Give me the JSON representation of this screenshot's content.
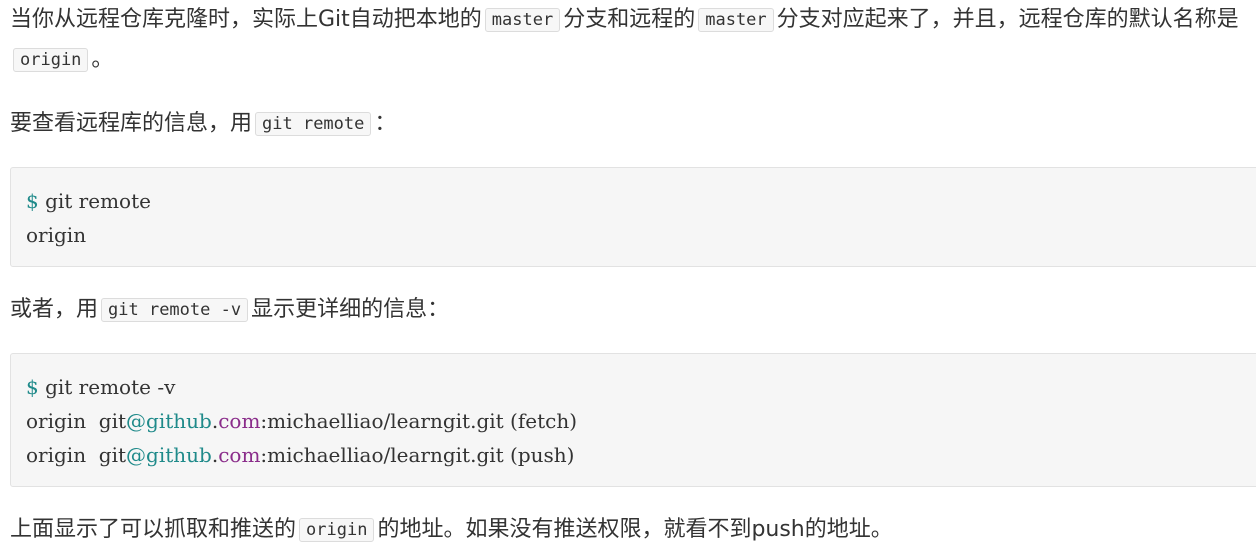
{
  "paragraphs": {
    "p1": {
      "text_a": "当你从远程仓库克隆时，实际上Git自动把本地的",
      "code_a": "master",
      "text_b": "分支和远程的",
      "code_b": "master",
      "text_c": "分支对应起来了，并且，远程仓库的默认名称是",
      "code_c": "origin",
      "text_d": "。"
    },
    "p2": {
      "text_a": "要查看远程库的信息，用",
      "code_a": "git remote",
      "text_b": "："
    },
    "p3": {
      "text_a": "或者，用",
      "code_a": "git remote -v",
      "text_b": "显示更详细的信息："
    },
    "p4": {
      "text_a": "上面显示了可以抓取和推送的",
      "code_a": "origin",
      "text_b": "的地址。如果没有推送权限，就看不到push的地址。"
    }
  },
  "code_blocks": {
    "block1": {
      "line1": {
        "prompt": "$",
        "command": " git remote"
      },
      "line2": {
        "text": "origin"
      }
    },
    "block2": {
      "line1": {
        "prompt": "$",
        "command": " git remote -v"
      },
      "line2": {
        "remote": "origin  git",
        "at": "@",
        "domain": "github",
        "dot": ".",
        "tld": "com",
        "path": ":michaelliao/learngit.git (fetch)"
      },
      "line3": {
        "remote": "origin  git",
        "at": "@",
        "domain": "github",
        "dot": ".",
        "tld": "com",
        "path": ":michaelliao/learngit.git (push)"
      }
    }
  }
}
